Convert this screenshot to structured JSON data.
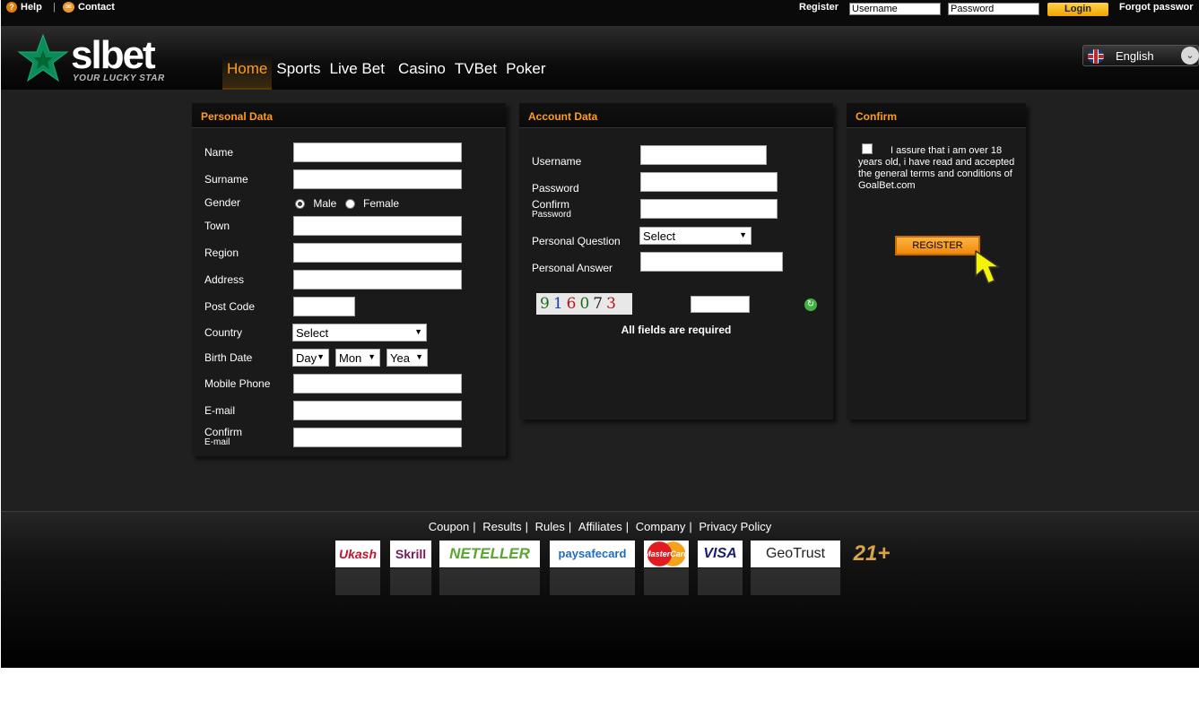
{
  "topbar": {
    "help": "Help",
    "contact": "Contact",
    "register": "Register",
    "username_placeholder": "Username",
    "password_placeholder": "Password",
    "login": "Login",
    "forgot": "Forgot passwor"
  },
  "header": {
    "logo": "slbet",
    "tagline": "YOUR LUCKY STAR",
    "nav": [
      "Home",
      "Sports",
      "Live Bet",
      "Casino",
      "TVBet",
      "Poker"
    ],
    "language": "English"
  },
  "personal": {
    "title": "Personal Data",
    "name": "Name",
    "surname": "Surname",
    "gender": "Gender",
    "male": "Male",
    "female": "Female",
    "town": "Town",
    "region": "Region",
    "address": "Address",
    "post_code": "Post Code",
    "country": "Country",
    "country_select": "Select",
    "birth_date": "Birth Date",
    "day": "Day",
    "month": "Mon",
    "year": "Yea",
    "mobile": "Mobile Phone",
    "email": "E-mail",
    "confirm": "Confirm",
    "confirm_sub": "E-mail"
  },
  "account": {
    "title": "Account Data",
    "username": "Username",
    "password": "Password",
    "confirm": "Confirm",
    "confirm_sub": "Password",
    "question": "Personal Question",
    "question_select": "Select",
    "answer": "Personal Answer",
    "captcha": "916073",
    "required": "All fields are required"
  },
  "confirm": {
    "title": "Confirm",
    "terms": "I assure that i am over 18 years old, i have read and accepted the general terms and conditions of GoalBet.com",
    "register_button": "REGISTER"
  },
  "footer": {
    "links": [
      "Coupon",
      "Results",
      "Rules",
      "Affiliates",
      "Company",
      "Privacy Policy"
    ],
    "payments": [
      "Ukash",
      "Skrill",
      "NETELLER",
      "paysafecard",
      "MasterCard",
      "VISA",
      "GeoTrust",
      "21+"
    ]
  }
}
